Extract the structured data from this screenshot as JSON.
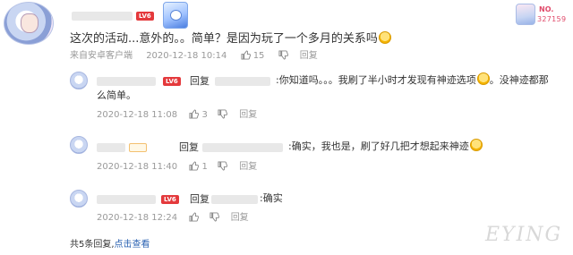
{
  "post": {
    "level_badge": "LV6",
    "text_before_emoji": "这次的活动...意外的。。简单？是因为玩了一个多月的关系吗",
    "source": "来自安卓客户端",
    "date": "2020-12-18 10:14",
    "likes": "15",
    "reply_label": "回复"
  },
  "side_user": {
    "no_label": "NO.",
    "number": "327159"
  },
  "replies": [
    {
      "level_badge": "LV6",
      "reply_word": "回复",
      "text_line1": ":你知道吗。。。我刷了半小时才发现有神迹选项",
      "text_line1_after": "。没神迹都那",
      "text_line2": "么简单。",
      "date": "2020-12-18 11:08",
      "likes": "3",
      "reply_label": "回复"
    },
    {
      "level_badge": "",
      "reply_word": "回复",
      "text_line1": ":确实，我也是，刷了好几把才想起来神迹",
      "date": "2020-12-18 11:40",
      "likes": "1",
      "reply_label": "回复"
    },
    {
      "level_badge": "LV6",
      "reply_word": "回复",
      "text_line1": ":确实",
      "date": "2020-12-18 12:24",
      "likes": "",
      "reply_label": "回复"
    }
  ],
  "footer": {
    "count_text": "共5条回复,",
    "link_text": "点击查看"
  },
  "watermark": {
    "text": "EYING"
  },
  "colors": {
    "link": "#2d64b3",
    "badge_red": "#e4393c",
    "meta_gray": "#999999"
  }
}
